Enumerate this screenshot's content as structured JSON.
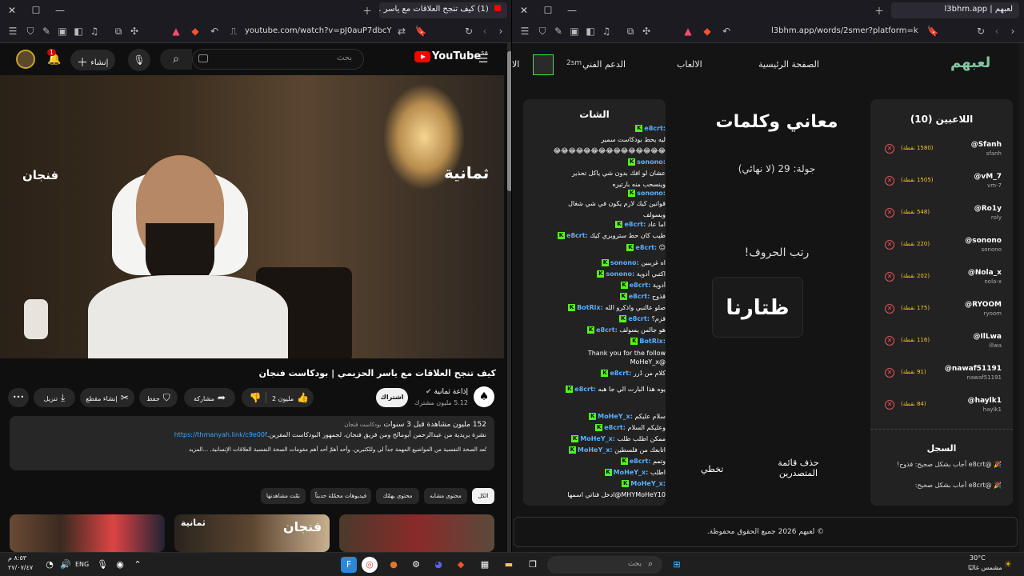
{
  "left_browser": {
    "tab_title": "(1) كيف تنجح العلاقات مع ياسر ...",
    "url": "youtube.com/watch?v=pJ0auP7dbcY&t=1..."
  },
  "youtube": {
    "logo": "YouTube",
    "logo_sup": "SA",
    "search_placeholder": "بحث",
    "create_label": "إنشاء",
    "bell_count": "1",
    "video_overlay_left": "فنجان",
    "video_overlay_right": "ثمانية",
    "title": "كيف تنجح العلاقات مع ياسر الحزيمي | بودكاست فنجان",
    "channel_name": "إذاعة ثمانية",
    "channel_subs": "5.12 مليون مشترك",
    "subscribe": "اشتراك",
    "like_label": "2 مليون",
    "share_label": "مشاركة",
    "save_label": "حفظ",
    "clip_label": "إنشاء مقطع",
    "download_label": "تنزيل",
    "desc_views": "152 مليون مشاهدة قبل 3 سنوات",
    "desc_hashtag": "بودكاست فنجان",
    "desc_line2_text": "نشرة بريدية من عبدالرحمن أبومالح ومن فريق فنجان، لجمهور البودكاست المفرين.",
    "desc_link": "https://thmanyah.link/c9e00f",
    "desc_line3": "تُعد الصحة النفسية من المواضيع المهمة جداً لي وللكثيرين. وأحد أهمّ أحد أهم مقومات الصحة النفسية العلاقات الإنسانية. ...المزيد",
    "chips": [
      "الكل",
      "محتوى مشابه",
      "محتوى يهمّك",
      "فيديوهات محمّلة حديثاً",
      "تمّت مشاهدتها"
    ],
    "thumb_label_1": "ثمانية",
    "thumb_label_2": "فنجان"
  },
  "right_browser": {
    "tab_title": "لعبهم | l3bhm.app",
    "url": "l3bhm.app/words/2smer?platform=kick"
  },
  "site": {
    "logo": "لعبهم",
    "nav": [
      "الصفحة الرئيسية",
      "الالعاب",
      "الدعم الفني",
      "الا"
    ],
    "username": "2sm",
    "players_title": "اللاعبين (10)",
    "players": [
      {
        "name": "@Sfanh",
        "handle": "sfanh",
        "points": "(1580 نقطة)"
      },
      {
        "name": "@vM_7",
        "handle": "vm-7",
        "points": "(1505 نقطة)"
      },
      {
        "name": "@Ro1y",
        "handle": "roly",
        "points": "(548 نقطة)"
      },
      {
        "name": "@sonono",
        "handle": "sonono",
        "points": "(220 نقطة)"
      },
      {
        "name": "@Nola_x",
        "handle": "nola-x",
        "points": "(202 نقطة)"
      },
      {
        "name": "@RYOOM",
        "handle": "ryoom",
        "points": "(175 نقطة)"
      },
      {
        "name": "@IlLwa",
        "handle": "illwa",
        "points": "(116 نقطة)"
      },
      {
        "name": "@nawaf51191",
        "handle": "nawaf51191",
        "points": "(91 نقطة)"
      },
      {
        "name": "@haylk1",
        "handle": "haylk1",
        "points": "(84 نقطة)"
      }
    ],
    "log_title": "السجل",
    "log": [
      "🎉 @e8crt أجاب بشكل صحيح: قذوح!",
      "🎉 @e8crt أجاب بشكل صحيح:"
    ],
    "game_title": "معاني وكلمات",
    "round": "جولة: 29 (لا نهائي)",
    "prompt": "رتب الحروف!",
    "word": "ظتارنا",
    "skip": "تخطي",
    "clear_leaderboard": "حذف قائمة المتصدرين",
    "chat_title": "الشات",
    "chat": [
      {
        "user": "e8crt:",
        "text": ""
      },
      {
        "user": "",
        "text": "ليه يحط بودكاست سمير"
      },
      {
        "user": "",
        "text": "😂😂😂😂😂😂😂😂😂😂😂😂😂😂😂"
      },
      {
        "user": "sonono:",
        "text": ""
      },
      {
        "user": "",
        "text": "عشان لو افك بدون شي ياكل تحذير"
      },
      {
        "user": "",
        "text": "وينسحب منه بارتيره"
      },
      {
        "user": "sonono:",
        "text": ""
      },
      {
        "user": "",
        "text": "قوانين كيك لازم يكون في شي شغال"
      },
      {
        "user": "",
        "text": "ويسولف"
      },
      {
        "user": "e8crt:",
        "text": "اما عاد"
      },
      {
        "user": "e8crt:",
        "text": "طيب كان حط ستروبري كيك"
      },
      {
        "user": "e8crt:",
        "text": "😐"
      },
      {
        "user": "sonono:",
        "text": "اه غريبين"
      },
      {
        "user": "sonono:",
        "text": "اكتبي أدوية"
      },
      {
        "user": "e8crt:",
        "text": "أدوية"
      },
      {
        "user": "e8crt:",
        "text": "قذوح"
      },
      {
        "user": "BotRix:",
        "text": "صلو عالنبي واذكرو الله"
      },
      {
        "user": "e8crt:",
        "text": "قزم؟"
      },
      {
        "user": "e8crt:",
        "text": "هو جالس يسولف"
      },
      {
        "user": "BotRix:",
        "text": ""
      },
      {
        "user": "",
        "text": "Thank you for the follow"
      },
      {
        "user": "",
        "text": "@MoHeY_x"
      },
      {
        "user": "e8crt:",
        "text": "كلام من دُرر"
      },
      {
        "user": "e8crt:",
        "text": "يوه هذا البارت الي جا هبه"
      },
      {
        "user": "",
        "text": ""
      },
      {
        "user": "MoHeY_x:",
        "text": "سلام عليكم"
      },
      {
        "user": "e8crt:",
        "text": "وعليكم السلام"
      },
      {
        "user": "MoHeY_x:",
        "text": "ممكن اطلب طلب"
      },
      {
        "user": "MoHeY_x:",
        "text": "اتابعك من فلسطين"
      },
      {
        "user": "e8crt:",
        "text": "وتمم"
      },
      {
        "user": "MoHeY_x:",
        "text": "اطلب"
      },
      {
        "user": "MoHeY_x:",
        "text": ""
      },
      {
        "user": "",
        "text": "MHYMoHeY10@ادخل قناتي اسمها"
      }
    ],
    "footer": "© لعبهم 2026 جميع الحقوق محفوظة."
  },
  "taskbar": {
    "search_placeholder": "بحث",
    "weather_temp": "30°C",
    "weather_desc": "مشمس غالبًا",
    "lang": "ENG",
    "time": "٨:٥٣ م",
    "date": "٢٧/٠٧/٤٧"
  },
  "colors": {
    "yt_red": "#ff0000",
    "kick_green": "#53fc18",
    "chat_user": "#5ab0ff",
    "points": "#f4c430",
    "remove": "#e55353",
    "logo_green": "#7fc8a0"
  }
}
